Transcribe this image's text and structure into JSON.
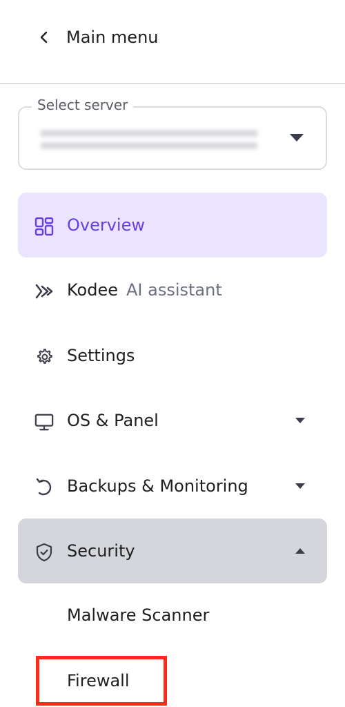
{
  "back": {
    "label": "Main menu",
    "icon": "chevron-left-icon"
  },
  "server_select": {
    "label": "Select server",
    "value_blurred": true,
    "icon": "caret-down-icon"
  },
  "nav": {
    "overview": {
      "label": "Overview",
      "icon": "grid-icon",
      "active": true
    },
    "kodee": {
      "label": "Kodee",
      "sublabel": "AI assistant",
      "icon": "kodee-icon"
    },
    "settings": {
      "label": "Settings",
      "icon": "gear-icon"
    },
    "os_panel": {
      "label": "OS & Panel",
      "icon": "monitor-icon",
      "expanded": false
    },
    "backups": {
      "label": "Backups & Monitoring",
      "icon": "restore-icon",
      "expanded": false
    },
    "security": {
      "label": "Security",
      "icon": "shield-check-icon",
      "expanded": true,
      "items": [
        {
          "label": "Malware Scanner"
        },
        {
          "label": "Firewall",
          "highlighted": true
        }
      ]
    }
  },
  "colors": {
    "accent": "#673de6",
    "active_bg": "#ebe4ff",
    "security_bg": "#d5d5dc",
    "highlight": "#ff2a1a"
  }
}
